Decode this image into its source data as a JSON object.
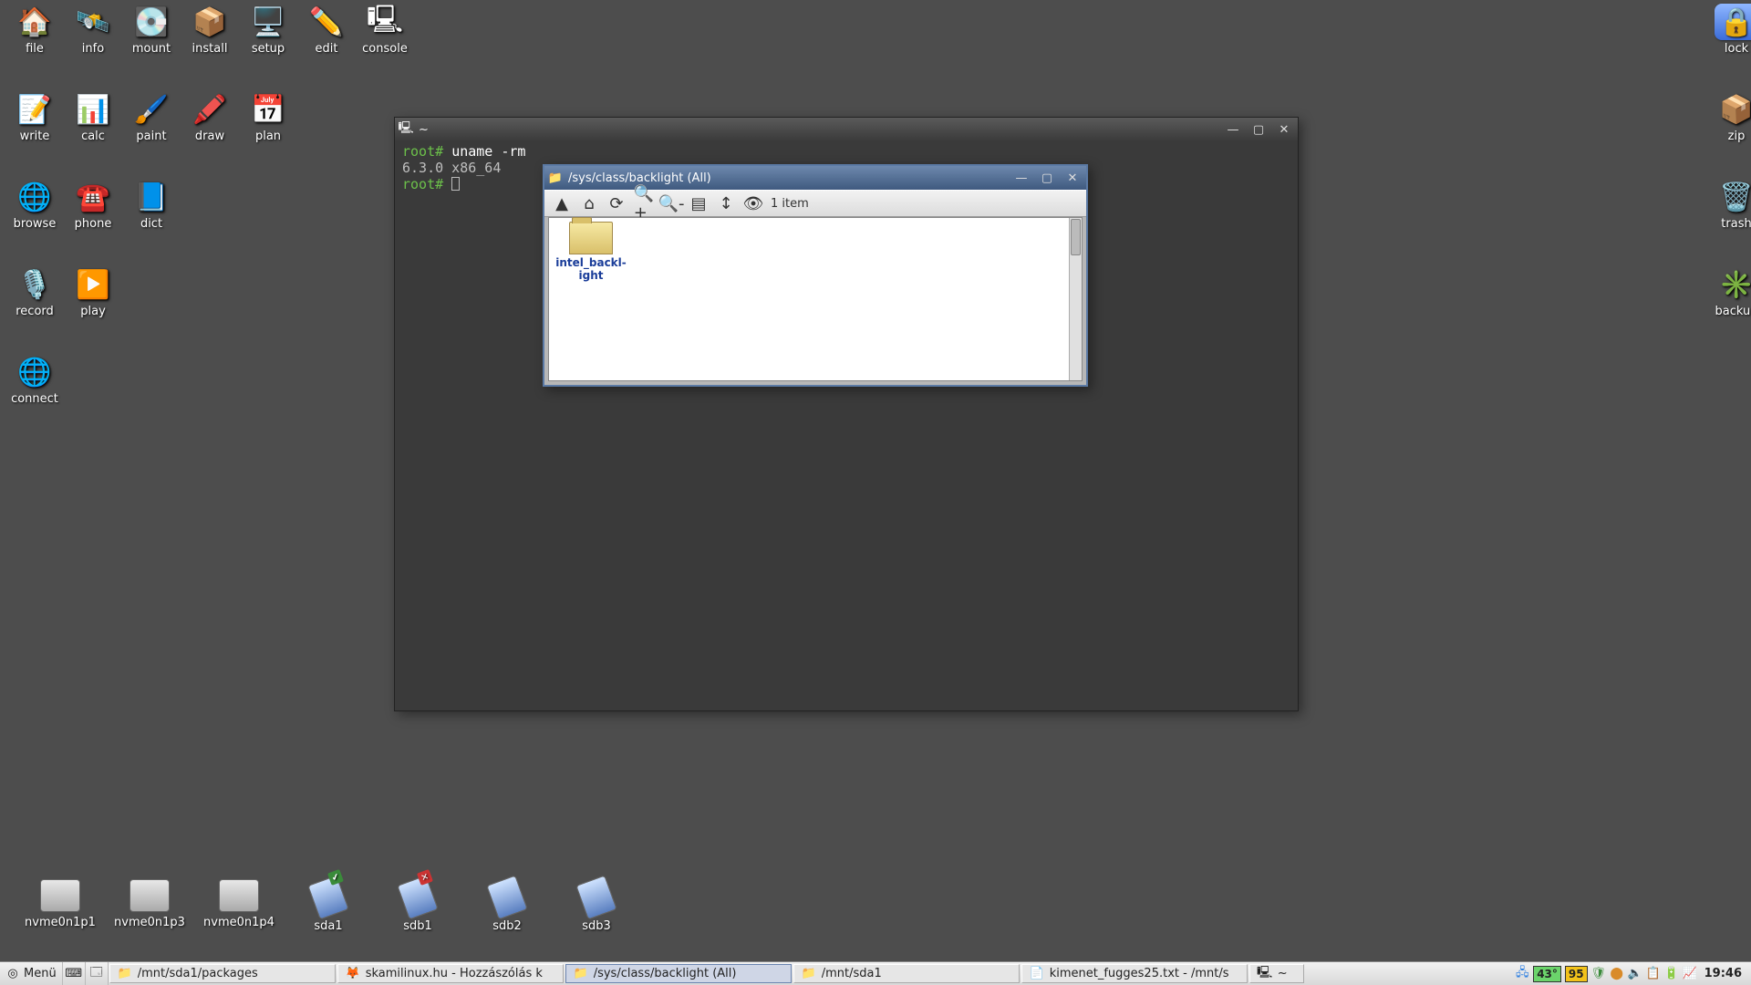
{
  "desktop": {
    "left_icons": [
      {
        "id": "file",
        "label": "file",
        "glyph": "🏠"
      },
      {
        "id": "info",
        "label": "info",
        "glyph": "🛰️"
      },
      {
        "id": "mount",
        "label": "mount",
        "glyph": "💽"
      },
      {
        "id": "install",
        "label": "install",
        "glyph": "📦"
      },
      {
        "id": "setup",
        "label": "setup",
        "glyph": "🖥️"
      },
      {
        "id": "edit",
        "label": "edit",
        "glyph": "✏️"
      },
      {
        "id": "console",
        "label": "console",
        "glyph": "🖳"
      },
      {
        "id": "write",
        "label": "write",
        "glyph": "📝"
      },
      {
        "id": "calc",
        "label": "calc",
        "glyph": "📊"
      },
      {
        "id": "paint",
        "label": "paint",
        "glyph": "🖌️"
      },
      {
        "id": "draw",
        "label": "draw",
        "glyph": "🖍️"
      },
      {
        "id": "plan",
        "label": "plan",
        "glyph": "📅"
      },
      {
        "id": "browse",
        "label": "browse",
        "glyph": "🌐"
      },
      {
        "id": "phone",
        "label": "phone",
        "glyph": "☎️"
      },
      {
        "id": "dict",
        "label": "dict",
        "glyph": "📘"
      },
      {
        "id": "record",
        "label": "record",
        "glyph": "🎙️"
      },
      {
        "id": "play",
        "label": "play",
        "glyph": "▶️"
      },
      {
        "id": "connect",
        "label": "connect",
        "glyph": "🌐"
      }
    ],
    "right_icons": [
      {
        "id": "lock",
        "label": "lock",
        "glyph": "🔒",
        "cls": "icon-lock"
      },
      {
        "id": "zip",
        "label": "zip",
        "glyph": "📦",
        "cls": "icon-zip"
      },
      {
        "id": "trash",
        "label": "trash",
        "glyph": "🗑️",
        "cls": "icon-trash"
      },
      {
        "id": "backup",
        "label": "backup",
        "glyph": "✳️",
        "cls": "icon-backup"
      }
    ],
    "drives": [
      {
        "id": "nvme0n1p1",
        "label": "nvme0n1p1",
        "type": "hd"
      },
      {
        "id": "nvme0n1p3",
        "label": "nvme0n1p3",
        "type": "hd"
      },
      {
        "id": "nvme0n1p4",
        "label": "nvme0n1p4",
        "type": "hd"
      },
      {
        "id": "sda1",
        "label": "sda1",
        "type": "usb",
        "mark": "ok"
      },
      {
        "id": "sdb1",
        "label": "sdb1",
        "type": "usb",
        "mark": "no"
      },
      {
        "id": "sdb2",
        "label": "sdb2",
        "type": "usb"
      },
      {
        "id": "sdb3",
        "label": "sdb3",
        "type": "usb"
      }
    ]
  },
  "terminal": {
    "title": "~",
    "prompt": "root#",
    "cmd": "uname -rm",
    "output": "6.3.0 x86_64"
  },
  "fm": {
    "title": "/sys/class/backlight (All)",
    "item_count": "1 item",
    "item_label": "intel_backl-\night"
  },
  "taskbar": {
    "menu": "Menü",
    "tasks": [
      {
        "id": "t1",
        "label": "/mnt/sda1/packages",
        "icon": "📁",
        "active": false
      },
      {
        "id": "t2",
        "label": "skamilinux.hu - Hozzászólás k",
        "icon": "🦊",
        "active": false
      },
      {
        "id": "t3",
        "label": "/sys/class/backlight (All)",
        "icon": "📁",
        "active": true
      },
      {
        "id": "t4",
        "label": "/mnt/sda1",
        "icon": "📁",
        "active": false
      },
      {
        "id": "t5",
        "label": "kimenet_fugges25.txt - /mnt/s",
        "icon": "📄",
        "active": false
      },
      {
        "id": "t6",
        "label": "~",
        "icon": "🖳",
        "active": false
      }
    ],
    "tray": {
      "temp": "43°",
      "cpu": "95",
      "clock": "19:46"
    }
  }
}
